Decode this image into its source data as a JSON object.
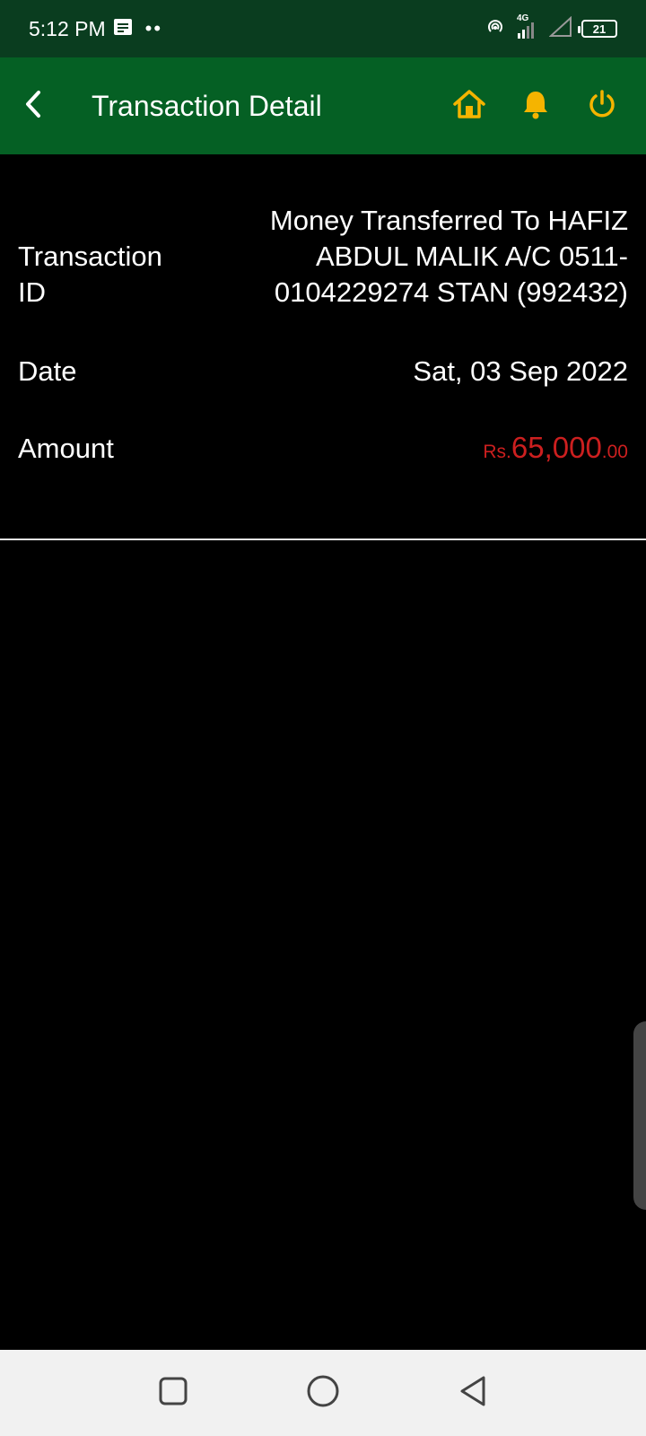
{
  "status_bar": {
    "time": "5:12 PM",
    "notification_dots": "••",
    "network_label": "4G",
    "battery_level": "21"
  },
  "app_bar": {
    "title": "Transaction Detail",
    "icon_color": "#f5b400",
    "background": "#056024"
  },
  "transaction": {
    "id_label": "Transaction ID",
    "id_value": "Money Transferred To HAFIZ ABDUL MALIK A/C 0511-0104229274 STAN (992432)",
    "date_label": "Date",
    "date_value": "Sat, 03 Sep 2022",
    "amount_label": "Amount",
    "amount_currency": "Rs.",
    "amount_main": "65,000",
    "amount_decimal": ".00",
    "amount_color": "#cc1f1f"
  },
  "nav_bar": {
    "buttons": [
      "recents",
      "home",
      "back"
    ]
  }
}
